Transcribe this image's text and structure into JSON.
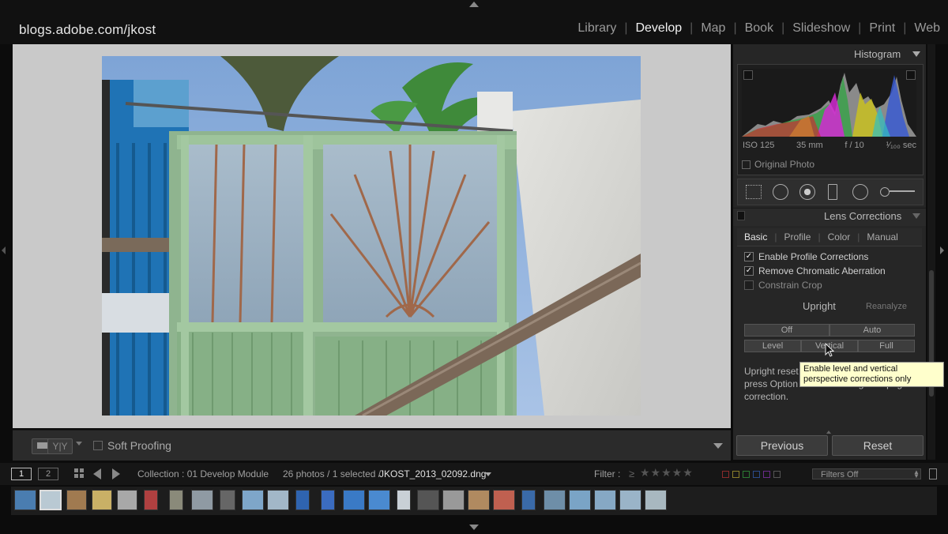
{
  "identity_plate": "blogs.adobe.com/jkost",
  "modules": [
    {
      "label": "Library",
      "active": false
    },
    {
      "label": "Develop",
      "active": true
    },
    {
      "label": "Map",
      "active": false
    },
    {
      "label": "Book",
      "active": false
    },
    {
      "label": "Slideshow",
      "active": false
    },
    {
      "label": "Print",
      "active": false
    },
    {
      "label": "Web",
      "active": false
    }
  ],
  "module_separator": "|",
  "toolbar": {
    "yy_label": "Y|Y",
    "soft_proofing_label": "Soft Proofing"
  },
  "histogram": {
    "title": "Histogram",
    "iso": "ISO 125",
    "focal_length": "35 mm",
    "aperture": "f / 10",
    "shutter": "¹⁄₁₀₀ sec",
    "original_photo_label": "Original Photo"
  },
  "lens_corrections": {
    "title": "Lens Corrections",
    "tabs": [
      {
        "label": "Basic",
        "active": true
      },
      {
        "label": "Profile",
        "active": false
      },
      {
        "label": "Color",
        "active": false
      },
      {
        "label": "Manual",
        "active": false
      }
    ],
    "checkboxes": [
      {
        "label": "Enable Profile Corrections",
        "checked": true
      },
      {
        "label": "Remove Chromatic Aberration",
        "checked": true
      },
      {
        "label": "Constrain Crop",
        "checked": false
      }
    ],
    "upright_label": "Upright",
    "reanalyze_label": "Reanalyze",
    "upright_buttons": {
      "off": "Off",
      "auto": "Auto",
      "level": "Level",
      "vertical": "Vertical",
      "full": "Full"
    },
    "description": "Upright reset correction set settings, press Option when choosing an Upright correction.",
    "tooltip": "Enable level and vertical perspective corrections only"
  },
  "buttons": {
    "previous": "Previous",
    "reset": "Reset"
  },
  "filmstrip_bar": {
    "screen_1": "1",
    "screen_2": "2",
    "collection": "Collection : 01 Develop Module",
    "photo_count": "26 photos / 1 selected /",
    "filename": "JKOST_2013_02092.dng",
    "filter_label": "Filter :",
    "filter_ge": "≥",
    "stars": "★★★★★",
    "filters_off": "Filters Off"
  },
  "colors": {
    "accent": "#e6e6e6",
    "label_red": "#8a2b2b",
    "label_yellow": "#8a7f2b",
    "label_green": "#2b7a33",
    "label_blue": "#2b4a8a",
    "label_purple": "#6a2b8a"
  }
}
